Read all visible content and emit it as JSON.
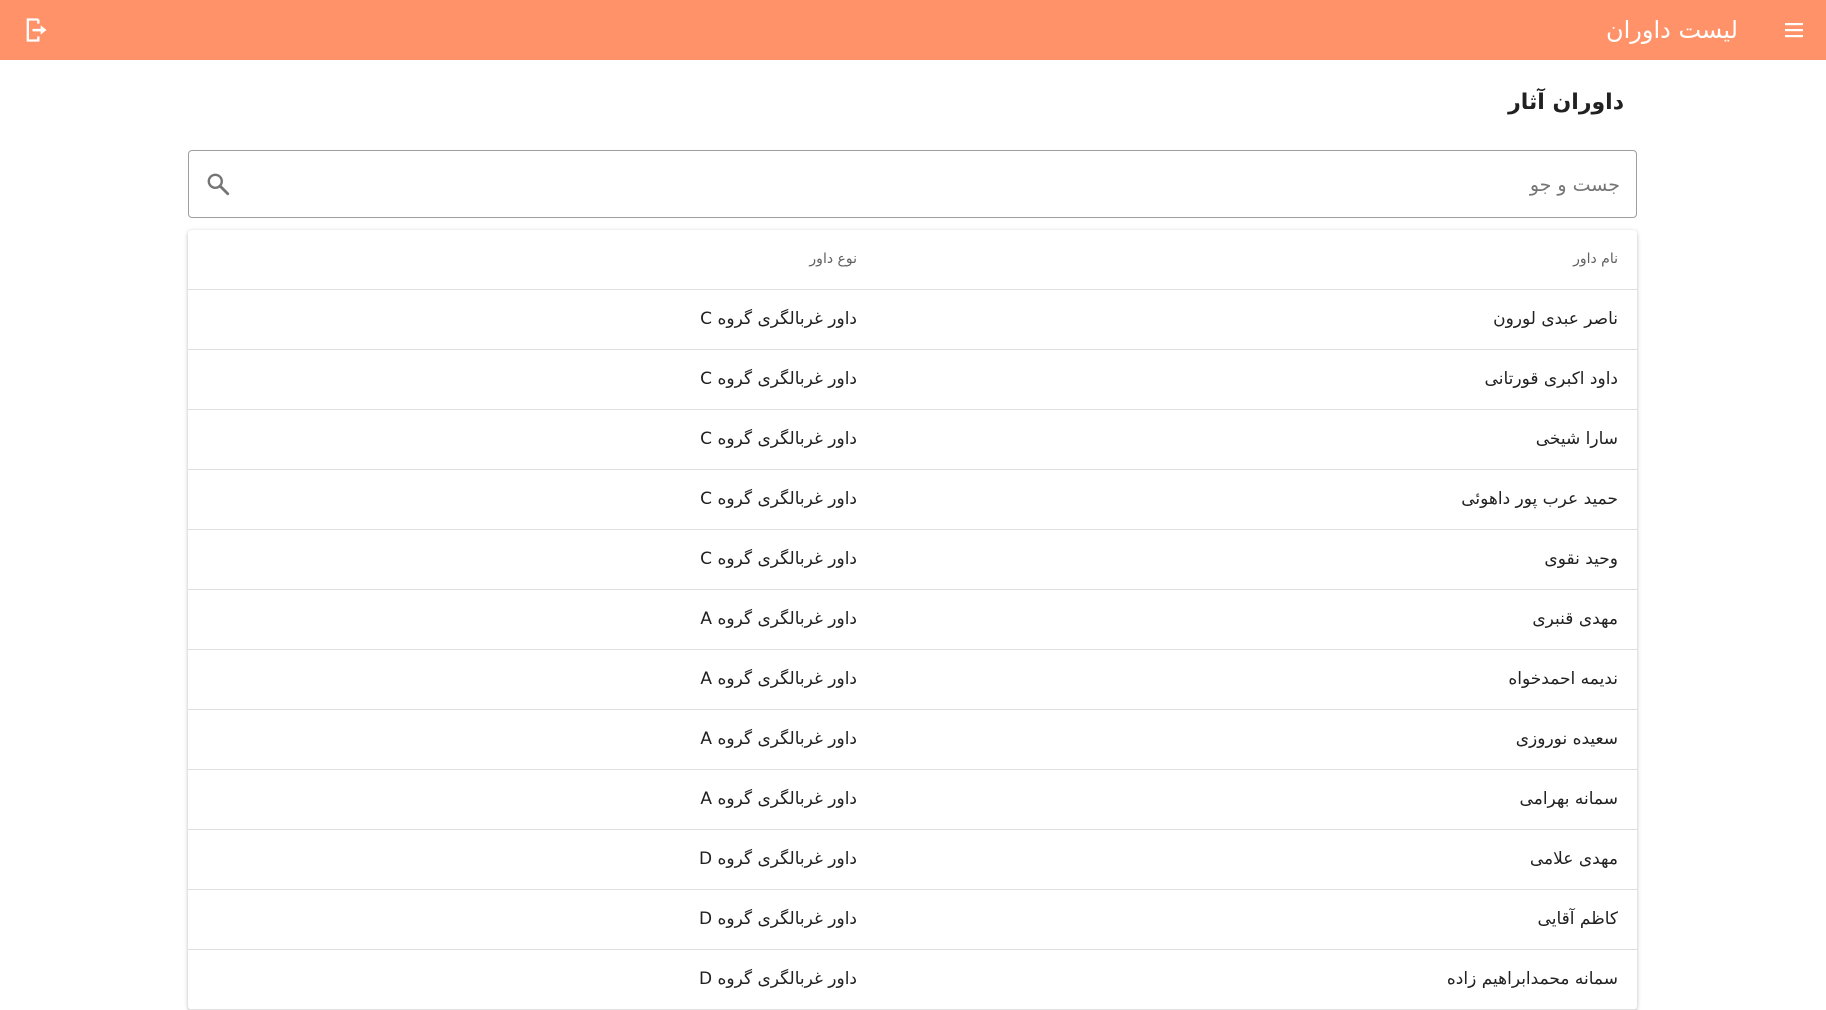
{
  "header": {
    "title": "لیست داوران",
    "menu_icon": "hamburger-menu-icon",
    "logout_icon": "logout-icon",
    "background": "#ff9268"
  },
  "main": {
    "heading": "داوران آثار",
    "search": {
      "placeholder": "جست و جو",
      "value": "",
      "icon": "search-icon"
    },
    "table": {
      "columns": [
        "نام داور",
        "نوع داور"
      ],
      "rows": [
        [
          "ناصر عبدی لورون",
          "داور غربالگری گروه C"
        ],
        [
          "داود اکبری قورتانی",
          "داور غربالگری گروه C"
        ],
        [
          "سارا شیخی",
          "داور غربالگری گروه C"
        ],
        [
          "حمید عرب پور داهوئی",
          "داور غربالگری گروه C"
        ],
        [
          "وحید نقوی",
          "داور غربالگری گروه C"
        ],
        [
          "مهدی قنبری",
          "داور غربالگری گروه A"
        ],
        [
          "ندیمه احمدخواه",
          "داور غربالگری گروه A"
        ],
        [
          "سعیده نوروزی",
          "داور غربالگری گروه A"
        ],
        [
          "سمانه بهرامی",
          "داور غربالگری گروه A"
        ],
        [
          "مهدی علامی",
          "داور غربالگری گروه D"
        ],
        [
          "کاظم آقایی",
          "داور غربالگری گروه D"
        ],
        [
          "سمانه محمدابراهیم زاده",
          "داور غربالگری گروه D"
        ]
      ]
    }
  }
}
